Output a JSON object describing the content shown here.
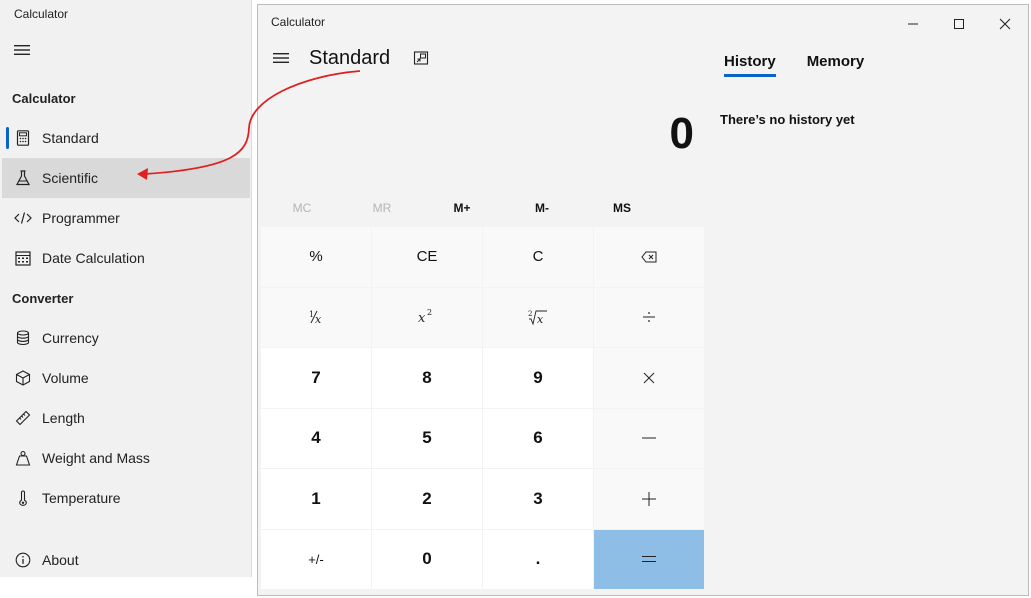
{
  "nav": {
    "app_title": "Calculator",
    "section_calculator": "Calculator",
    "section_converter": "Converter",
    "items": {
      "standard": "Standard",
      "scientific": "Scientific",
      "programmer": "Programmer",
      "date": "Date Calculation",
      "currency": "Currency",
      "volume": "Volume",
      "length": "Length",
      "weight": "Weight and Mass",
      "temperature": "Temperature",
      "about": "About"
    }
  },
  "window": {
    "title": "Calculator",
    "mode": "Standard",
    "display": "0"
  },
  "memory": {
    "mc": "MC",
    "mr": "MR",
    "mplus": "M+",
    "mminus": "M-",
    "ms": "MS"
  },
  "keys": {
    "percent": "%",
    "ce": "CE",
    "c": "C",
    "seven": "7",
    "eight": "8",
    "nine": "9",
    "four": "4",
    "five": "5",
    "six": "6",
    "one": "1",
    "two": "2",
    "three": "3",
    "negate": "+/-",
    "zero": "0",
    "decimal": "."
  },
  "panel": {
    "tab_history": "History",
    "tab_memory": "Memory",
    "history_empty": "There’s no history yet"
  },
  "colors": {
    "accent": "#0a64c8",
    "equals_key": "#8ebde6",
    "annotation_arrow": "#e02020"
  },
  "icons": {
    "backspace": "backspace-icon",
    "divide": "divide-icon",
    "multiply": "multiply-icon",
    "minus": "minus-icon",
    "plus": "plus-icon",
    "equals": "equals-icon"
  }
}
